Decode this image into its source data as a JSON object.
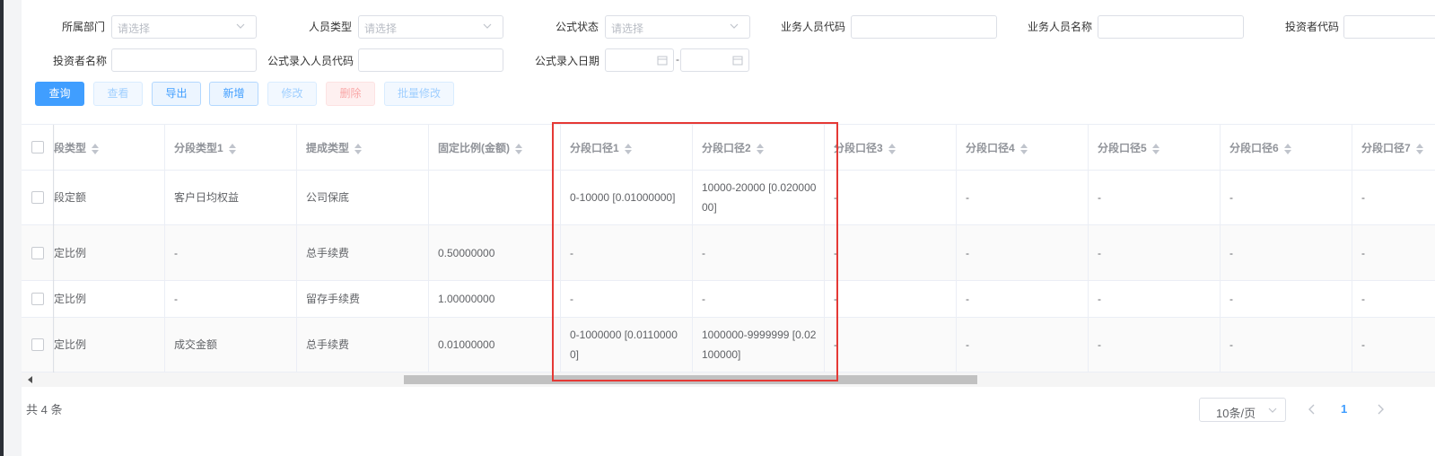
{
  "filters": {
    "dept_label": "所属部门",
    "dept_placeholder": "请选择",
    "staff_type_label": "人员类型",
    "staff_type_placeholder": "请选择",
    "formula_status_label": "公式状态",
    "formula_status_placeholder": "请选择",
    "agent_code_label": "业务人员代码",
    "agent_name_label": "业务人员名称",
    "investor_code_label": "投资者代码",
    "investor_name_label": "投资者名称",
    "entry_staff_code_label": "公式录入人员代码",
    "entry_date_label": "公式录入日期",
    "date_separator": "-"
  },
  "toolbar": {
    "query": "查询",
    "view": "查看",
    "export": "导出",
    "add": "新增",
    "edit": "修改",
    "delete": "删除",
    "batch_edit": "批量修改"
  },
  "table": {
    "columns": [
      "段类型",
      "分段类型1",
      "提成类型",
      "固定比例(金额)",
      "分段口径1",
      "分段口径2",
      "分段口径3",
      "分段口径4",
      "分段口径5",
      "分段口径6",
      "分段口径7"
    ],
    "rows": [
      [
        "段定额",
        "客户日均权益",
        "公司保底",
        "",
        "0-10000 [0.01000000]",
        "10000-20000 [0.02000000]",
        "-",
        "-",
        "-",
        "-",
        "-"
      ],
      [
        "定比例",
        "-",
        "总手续费",
        "0.50000000",
        "-",
        "-",
        "-",
        "-",
        "-",
        "-",
        "-"
      ],
      [
        "定比例",
        "-",
        "留存手续费",
        "1.00000000",
        "-",
        "-",
        "-",
        "-",
        "-",
        "-",
        "-"
      ],
      [
        "定比例",
        "成交金额",
        "总手续费",
        "0.01000000",
        "0-1000000 [0.01100000]",
        "1000000-9999999 [0.02100000]",
        "-",
        "-",
        "-",
        "-",
        "-"
      ]
    ]
  },
  "pagination": {
    "total": "共 4 条",
    "page_size": "10条/页",
    "current_page": "1"
  },
  "colors": {
    "primary": "#409eff",
    "highlight": "#e53935"
  }
}
